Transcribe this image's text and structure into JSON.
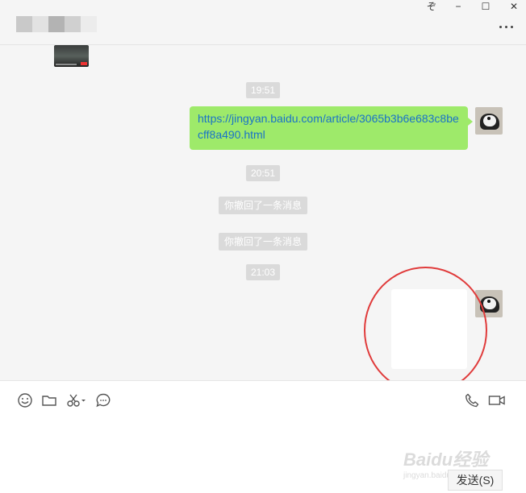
{
  "window": {
    "controls": {
      "pin": "ぞ",
      "minimize": "−",
      "maximize": "☐",
      "close": "✕"
    },
    "more_icon": "more-dots-icon"
  },
  "chat": {
    "messages": [
      {
        "type": "video",
        "from": "other"
      },
      {
        "type": "time",
        "text": "19:51"
      },
      {
        "type": "link",
        "from": "me",
        "text": "https://jingyan.baidu.com/article/3065b3b6e683c8becff8a490.html"
      },
      {
        "type": "time",
        "text": "20:51"
      },
      {
        "type": "system",
        "text": "你撤回了一条消息"
      },
      {
        "type": "system",
        "text": "你撤回了一条消息"
      },
      {
        "type": "time",
        "text": "21:03"
      },
      {
        "type": "blank",
        "from": "me"
      }
    ],
    "annotation_color": "#e03b3b",
    "bubble_color": "#9eea6a"
  },
  "toolbar": {
    "left_icons": [
      "emoji-icon",
      "folder-icon",
      "scissors-icon",
      "chat-history-icon"
    ],
    "right_icons": [
      "phone-icon",
      "video-call-icon"
    ]
  },
  "input": {
    "send_label": "发送(S)"
  },
  "watermark": {
    "text": "Baidu经验",
    "sub": "jingyan.baidu.com"
  }
}
